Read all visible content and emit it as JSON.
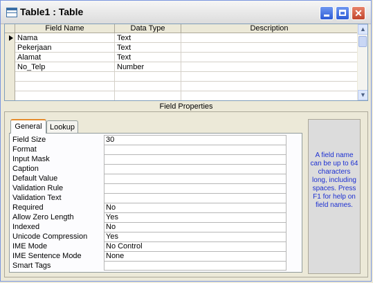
{
  "window": {
    "title": "Table1 : Table"
  },
  "grid": {
    "headers": {
      "field_name": "Field Name",
      "data_type": "Data Type",
      "description": "Description"
    },
    "rows": [
      {
        "field": "Nama",
        "type": "Text",
        "desc": ""
      },
      {
        "field": "Pekerjaan",
        "type": "Text",
        "desc": ""
      },
      {
        "field": "Alamat",
        "type": "Text",
        "desc": ""
      },
      {
        "field": "No_Telp",
        "type": "Number",
        "desc": ""
      },
      {
        "field": "",
        "type": "",
        "desc": ""
      },
      {
        "field": "",
        "type": "",
        "desc": ""
      },
      {
        "field": "",
        "type": "",
        "desc": ""
      }
    ]
  },
  "field_properties": {
    "title": "Field Properties",
    "tabs": {
      "general": "General",
      "lookup": "Lookup"
    },
    "rows": [
      {
        "label": "Field Size",
        "value": "30"
      },
      {
        "label": "Format",
        "value": ""
      },
      {
        "label": "Input Mask",
        "value": ""
      },
      {
        "label": "Caption",
        "value": ""
      },
      {
        "label": "Default Value",
        "value": ""
      },
      {
        "label": "Validation Rule",
        "value": ""
      },
      {
        "label": "Validation Text",
        "value": ""
      },
      {
        "label": "Required",
        "value": "No"
      },
      {
        "label": "Allow Zero Length",
        "value": "Yes"
      },
      {
        "label": "Indexed",
        "value": "No"
      },
      {
        "label": "Unicode Compression",
        "value": "Yes"
      },
      {
        "label": "IME Mode",
        "value": "No Control"
      },
      {
        "label": "IME Sentence Mode",
        "value": "None"
      },
      {
        "label": "Smart Tags",
        "value": ""
      }
    ],
    "help_text": "A field name can be up to 64 characters long, including spaces. Press F1 for help on field names."
  },
  "icons": {
    "table": "table-icon",
    "minimize": "minimize-icon",
    "maximize": "maximize-icon",
    "close": "close-icon",
    "row_selector": "current-row-arrow-icon",
    "scroll_up": "scroll-up-icon",
    "scroll_down": "scroll-down-icon"
  },
  "colors": {
    "help_text": "#1c2fd1",
    "close_button": "#c1442b",
    "tab_accent": "#e68b2c"
  }
}
